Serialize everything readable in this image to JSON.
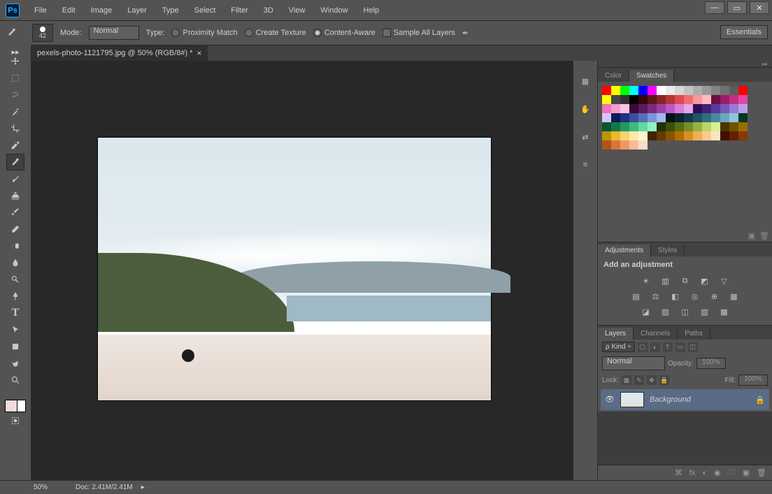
{
  "app": {
    "logo": "Ps"
  },
  "menu": [
    "File",
    "Edit",
    "Image",
    "Layer",
    "Type",
    "Select",
    "Filter",
    "3D",
    "View",
    "Window",
    "Help"
  ],
  "options": {
    "brush_size": "42",
    "mode_label": "Mode:",
    "mode_value": "Normal",
    "type_label": "Type:",
    "types": [
      {
        "label": "Proximity Match",
        "checked": false
      },
      {
        "label": "Create Texture",
        "checked": false
      },
      {
        "label": "Content-Aware",
        "checked": true
      }
    ],
    "sample_all": "Sample All Layers",
    "essentials": "Essentials"
  },
  "doc_tab": {
    "title": "pexels-photo-1121795.jpg @ 50% (RGB/8#) *"
  },
  "swatches_panel": {
    "tabs": [
      "Color",
      "Swatches"
    ],
    "active": 1,
    "colors": [
      "#ff0000",
      "#ffff00",
      "#00ff00",
      "#00ffff",
      "#0000ff",
      "#ff00ff",
      "#ffffff",
      "#ebebeb",
      "#d6d6d6",
      "#c2c2c2",
      "#adadad",
      "#999999",
      "#858585",
      "#707070",
      "#5c5c5c",
      "#ff0000",
      "#ffff00",
      "#474747",
      "#333333",
      "#000000",
      "#3a060a",
      "#5e1619",
      "#882427",
      "#b33538",
      "#df4a4d",
      "#f06e71",
      "#f89698",
      "#fbbdbe",
      "#6f0e46",
      "#9b1c66",
      "#c22e85",
      "#e546a6",
      "#ee72bd",
      "#f49dd2",
      "#f9c5e5",
      "#3b0a3f",
      "#5a195f",
      "#7b2b82",
      "#9c40a4",
      "#bf57c8",
      "#d77ed9",
      "#e7a6e8",
      "#2d0b58",
      "#422078",
      "#5b3a9a",
      "#7758bb",
      "#977bd7",
      "#b89feb",
      "#d6c5f7",
      "#0b1b57",
      "#203378",
      "#394f9a",
      "#576fbb",
      "#7b93d7",
      "#a1b7ec",
      "#001219",
      "#0a2430",
      "#153a49",
      "#225264",
      "#326d81",
      "#4a8aa0",
      "#6aa8bd",
      "#8fc6d8",
      "#003820",
      "#085633",
      "#147648",
      "#249861",
      "#3fba7d",
      "#64d89e",
      "#91efc0",
      "#233300",
      "#3a4f07",
      "#566e14",
      "#749026",
      "#96b441",
      "#b9d765",
      "#d7f195",
      "#4a3600",
      "#6f5200",
      "#967000",
      "#c09300",
      "#e9b92f",
      "#f6d46b",
      "#fce9a8",
      "#fff5d2",
      "#402400",
      "#633a00",
      "#895200",
      "#b06e00",
      "#d88f24",
      "#f1af55",
      "#f9cb8d",
      "#fde4c0",
      "#3f0f00",
      "#642000",
      "#8b3608",
      "#b3521d",
      "#d9743d",
      "#ef9766",
      "#f8bb97",
      "#fcddc7"
    ]
  },
  "adjustments_panel": {
    "tabs": [
      "Adjustments",
      "Styles"
    ],
    "active": 0,
    "title": "Add an adjustment"
  },
  "layers_panel": {
    "tabs": [
      "Layers",
      "Channels",
      "Paths"
    ],
    "active": 0,
    "kind_label": "Kind",
    "blend": "Normal",
    "opacity_label": "Opacity:",
    "opacity_value": "100%",
    "lock_label": "Lock:",
    "fill_label": "Fill:",
    "fill_value": "100%",
    "layer_name": "Background"
  },
  "status": {
    "zoom": "50%",
    "doc": "Doc: 2.41M/2.41M"
  }
}
